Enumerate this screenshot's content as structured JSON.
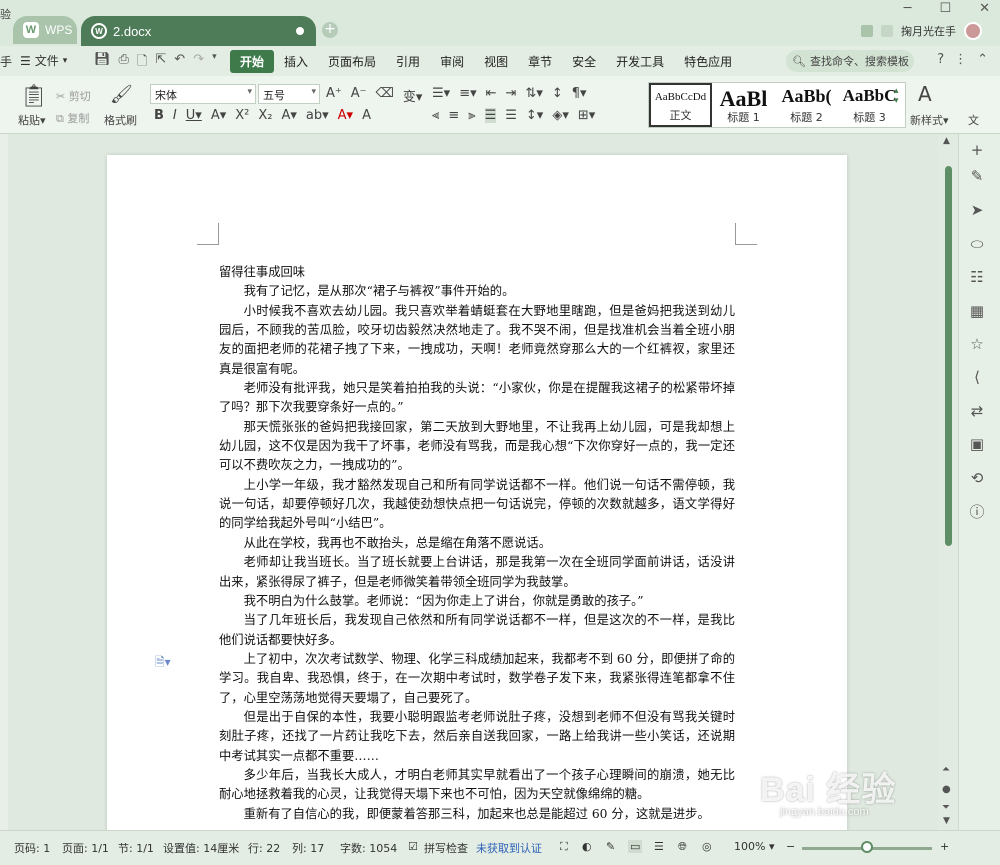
{
  "titlebar": {
    "edge_glyph": "验",
    "wps_tab": "WPS",
    "doc_tab": "2.docx",
    "user_name": "掬月光在手"
  },
  "menubar": {
    "edge_glyph": "手",
    "file_label": "文件",
    "items": [
      "开始",
      "插入",
      "页面布局",
      "引用",
      "审阅",
      "视图",
      "章节",
      "安全",
      "开发工具",
      "特色应用"
    ],
    "active_index": 0,
    "search_placeholder": "查找命令、搜索模板"
  },
  "ribbon": {
    "paste": "粘贴",
    "cut": "剪切",
    "copy": "复制",
    "format_painter": "格式刷",
    "font_name": "宋体",
    "font_size": "五号",
    "new_style": "新样式",
    "right_cut": "文",
    "styles": [
      {
        "sample": "AaBbCcDd",
        "name": "正文"
      },
      {
        "sample": "AaBl",
        "name": "标题 1"
      },
      {
        "sample": "AaBb(",
        "name": "标题 2"
      },
      {
        "sample": "AaBbC",
        "name": "标题 3"
      }
    ]
  },
  "document": {
    "title": "留得往事成回味",
    "paragraphs": [
      "我有了记忆，是从那次“裙子与裤衩”事件开始的。",
      "小时候我不喜欢去幼儿园。我只喜欢举着蜻蜓套在大野地里瞎跑，但是爸妈把我送到幼儿园后，不顾我的苦瓜脸，咬牙切齿毅然决然地走了。我不哭不闹，但是找准机会当着全班小朋友的面把老师的花裙子拽了下来，一拽成功，天啊！老师竟然穿那么大的一个红裤衩，家里还真是很富有呢。",
      "老师没有批评我，她只是笑着拍拍我的头说：“小家伙，你是在提醒我这裙子的松紧带坏掉了吗？那下次我要穿条好一点的。”",
      "那天慌张张的爸妈把我接回家，第二天放到大野地里，不让我再上幼儿园，可是我却想上幼儿园，这不仅是因为我干了坏事，老师没有骂我，而是我心想“下次你穿好一点的，我一定还可以不费吹灰之力，一拽成功的”。",
      "上小学一年级，我才豁然发现自己和所有同学说话都不一样。他们说一句话不需停顿，我说一句话，却要停顿好几次，我越使劲想快点把一句话说完，停顿的次数就越多，语文学得好的同学给我起外号叫“小结巴”。",
      "从此在学校，我再也不敢抬头，总是缩在角落不愿说话。",
      "老师却让我当班长。当了班长就要上台讲话，那是我第一次在全班同学面前讲话，话没讲出来，紧张得尿了裤子，但是老师微笑着带领全班同学为我鼓掌。",
      "我不明白为什么鼓掌。老师说：“因为你走上了讲台，你就是勇敢的孩子。”",
      "当了几年班长后，我发现自己依然和所有同学说话都不一样，但是这次的不一样，是我比他们说话都要快好多。",
      "上了初中，次次考试数学、物理、化学三科成绩加起来，我都考不到 60 分，即便拼了命的学习。我自卑、我恐惧，终于，在一次期中考试时，数学卷子发下来，我紧张得连笔都拿不住了，心里空荡荡地觉得天要塌了，自己要死了。",
      "但是出于自保的本性，我要小聪明跟监考老师说肚子疼，没想到老师不但没有骂我关键时刻肚子疼，还找了一片药让我吃下去，然后亲自送我回家，一路上给我讲一些小笑话，还说期中考试其实一点都不重要……",
      "多少年后，当我长大成人，才明白老师其实早就看出了一个孩子心理瞬间的崩溃，她无比耐心地拯救着我的心灵，让我觉得天塌下来也不可怕，因为天空就像绵绵的糖。",
      "重新有了自信心的我，即便蒙着答那三科，加起来也总是能超过 60 分，这就是进步。"
    ]
  },
  "statusbar": {
    "page_num": "页码: 1",
    "pages": "页面: 1/1",
    "section": "节: 1/1",
    "setting": "设置值: 14厘米",
    "row": "行: 22",
    "col": "列: 17",
    "word_count": "字数: 1054",
    "spell_check": "拼写检查",
    "auth_status": "未获取到认证",
    "zoom": "100%"
  },
  "watermark": {
    "text": "Bai 经验",
    "url": "jingyan.baidu.com"
  }
}
